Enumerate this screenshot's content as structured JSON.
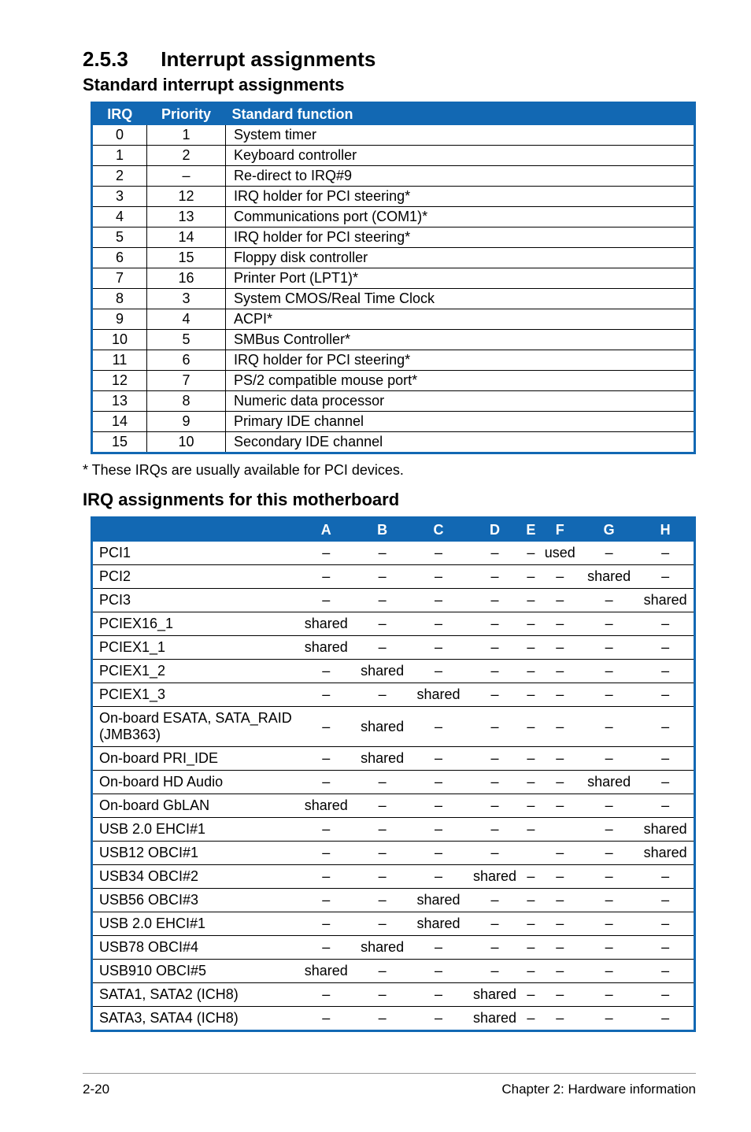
{
  "section": {
    "number": "2.5.3",
    "title": "Interrupt assignments"
  },
  "subtitle1": "Standard interrupt assignments",
  "irq_headers": {
    "c1": "IRQ",
    "c2": "Priority",
    "c3": "Standard function"
  },
  "irq_rows": [
    {
      "irq": "0",
      "priority": "1",
      "func": "System timer"
    },
    {
      "irq": "1",
      "priority": "2",
      "func": "Keyboard controller"
    },
    {
      "irq": "2",
      "priority": "–",
      "func": "Re-direct to IRQ#9"
    },
    {
      "irq": "3",
      "priority": "12",
      "func": "IRQ holder for PCI steering*"
    },
    {
      "irq": "4",
      "priority": "13",
      "func": "Communications port (COM1)*"
    },
    {
      "irq": "5",
      "priority": "14",
      "func": "IRQ holder for PCI steering*"
    },
    {
      "irq": "6",
      "priority": "15",
      "func": "Floppy disk controller"
    },
    {
      "irq": "7",
      "priority": "16",
      "func": "Printer Port (LPT1)*"
    },
    {
      "irq": "8",
      "priority": "3",
      "func": "System CMOS/Real Time Clock"
    },
    {
      "irq": "9",
      "priority": "4",
      "func": "ACPI*"
    },
    {
      "irq": "10",
      "priority": "5",
      "func": "SMBus Controller*"
    },
    {
      "irq": "11",
      "priority": "6",
      "func": "IRQ holder for PCI steering*"
    },
    {
      "irq": "12",
      "priority": "7",
      "func": "PS/2 compatible mouse port*"
    },
    {
      "irq": "13",
      "priority": "8",
      "func": "Numeric data processor"
    },
    {
      "irq": "14",
      "priority": "9",
      "func": "Primary IDE channel"
    },
    {
      "irq": "15",
      "priority": "10",
      "func": "Secondary IDE channel"
    }
  ],
  "footnote": "* These IRQs are usually available for PCI devices.",
  "subtitle2": "IRQ assignments for this motherboard",
  "mb_headers": [
    "A",
    "B",
    "C",
    "D",
    "E",
    "F",
    "G",
    "H"
  ],
  "mb_rows": [
    {
      "label": "PCI1",
      "cells": [
        "–",
        "–",
        "–",
        "–",
        "–",
        "used",
        "–",
        "–"
      ]
    },
    {
      "label": "PCI2",
      "cells": [
        "–",
        "–",
        "–",
        "–",
        "–",
        "–",
        "shared",
        "–"
      ]
    },
    {
      "label": "PCI3",
      "cells": [
        "–",
        "–",
        "–",
        "–",
        "–",
        "–",
        "–",
        "shared"
      ]
    },
    {
      "label": "PCIEX16_1",
      "cells": [
        "shared",
        "–",
        "–",
        "–",
        "–",
        "–",
        "–",
        "–"
      ]
    },
    {
      "label": "PCIEX1_1",
      "cells": [
        "shared",
        "–",
        "–",
        "–",
        "–",
        "–",
        "–",
        "–"
      ]
    },
    {
      "label": "PCIEX1_2",
      "cells": [
        "–",
        "shared",
        "–",
        "–",
        "–",
        "–",
        "–",
        "–"
      ]
    },
    {
      "label": "PCIEX1_3",
      "cells": [
        "–",
        "–",
        "shared",
        "–",
        "–",
        "–",
        "–",
        "–"
      ]
    },
    {
      "label": "On-board ESATA, SATA_RAID (JMB363)",
      "cells": [
        "–",
        "shared",
        "–",
        "–",
        "–",
        "–",
        "–",
        "–"
      ]
    },
    {
      "label": "On-board PRI_IDE",
      "cells": [
        "–",
        "shared",
        "–",
        "–",
        "–",
        "–",
        "–",
        "–"
      ]
    },
    {
      "label": "On-board HD Audio",
      "cells": [
        "–",
        "–",
        "–",
        "–",
        "–",
        "–",
        "shared",
        "–"
      ]
    },
    {
      "label": "On-board GbLAN",
      "cells": [
        "shared",
        "–",
        "–",
        "–",
        "–",
        "–",
        "–",
        "–"
      ]
    },
    {
      "label": "USB 2.0 EHCI#1",
      "cells": [
        "–",
        "–",
        "–",
        "–",
        "–",
        "",
        "–",
        "shared"
      ]
    },
    {
      "label": "USB12 OBCI#1",
      "cells": [
        "–",
        "–",
        "–",
        "–",
        "",
        "–",
        "–",
        "shared"
      ]
    },
    {
      "label": "USB34 OBCI#2",
      "cells": [
        "–",
        "–",
        "–",
        "shared",
        "–",
        "–",
        "–",
        "–"
      ]
    },
    {
      "label": "USB56 OBCI#3",
      "cells": [
        "–",
        "–",
        "shared",
        "–",
        "–",
        "–",
        "–",
        "–"
      ]
    },
    {
      "label": "USB 2.0 EHCI#1",
      "cells": [
        "–",
        "–",
        "shared",
        "–",
        "–",
        "–",
        "–",
        "–"
      ]
    },
    {
      "label": "USB78 OBCI#4",
      "cells": [
        "–",
        "shared",
        "–",
        "–",
        "–",
        "–",
        "–",
        "–"
      ]
    },
    {
      "label": "USB910 OBCI#5",
      "cells": [
        "shared",
        "–",
        "–",
        "–",
        "–",
        "–",
        "–",
        "–"
      ]
    },
    {
      "label": "SATA1, SATA2 (ICH8)",
      "cells": [
        "–",
        "–",
        "–",
        "shared",
        "–",
        "–",
        "–",
        "–"
      ]
    },
    {
      "label": "SATA3, SATA4 (ICH8)",
      "cells": [
        "–",
        "–",
        "–",
        "shared",
        "–",
        "–",
        "–",
        "–"
      ]
    }
  ],
  "footer": {
    "left": "2-20",
    "right": "Chapter 2: Hardware information"
  }
}
